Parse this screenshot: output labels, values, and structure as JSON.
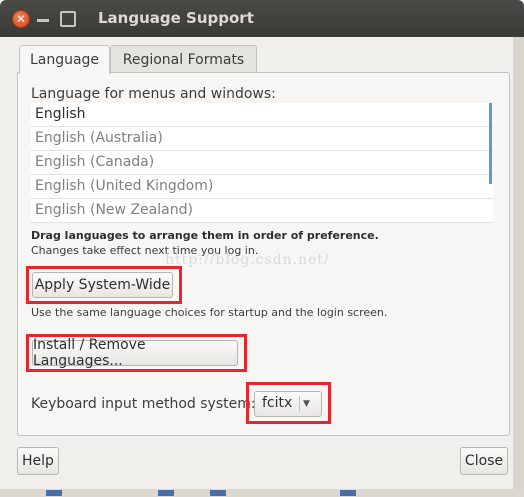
{
  "window": {
    "title": "Language Support"
  },
  "tabs": [
    {
      "label": "Language",
      "active": true
    },
    {
      "label": "Regional Formats",
      "active": false
    }
  ],
  "language_section": {
    "label": "Language for menus and windows:",
    "languages": [
      "English",
      "English (Australia)",
      "English (Canada)",
      "English (United Kingdom)",
      "English (New Zealand)"
    ],
    "drag_note": "Drag languages to arrange them in order of preference.",
    "changes_note": "Changes take effect next time you log in."
  },
  "watermark": "http://blog.csdn.net/",
  "apply_button": {
    "label": "Apply System-Wide"
  },
  "same_lang_note": "Use the same language choices for startup and the login screen.",
  "install_button": {
    "label": "Install / Remove Languages..."
  },
  "keyboard": {
    "label": "Keyboard input method system:",
    "selected": "fcitx"
  },
  "footer": {
    "help_label": "Help",
    "close_label": "Close"
  },
  "colors": {
    "highlight_red": "#e6252d",
    "titlebar": "#3c3b37",
    "scroll_accent": "#5b9bd5"
  },
  "icons": [
    "close-icon",
    "minimize-icon",
    "maximize-icon",
    "dropdown-arrow-icon"
  ]
}
